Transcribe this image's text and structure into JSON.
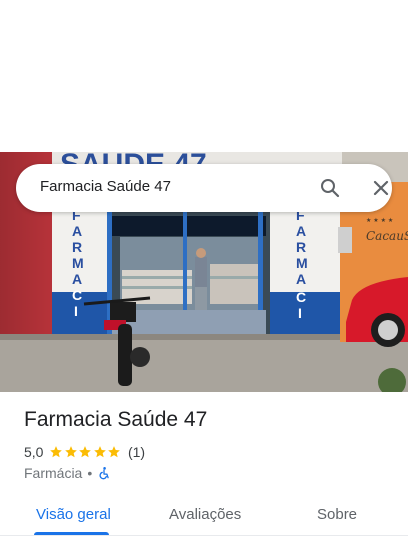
{
  "search": {
    "query": "Farmacia Saúde 47"
  },
  "photo": {
    "sign_text": "SAÚDE 47",
    "left_column_text": "FARMACIA",
    "right_column_text": "FARMACIA",
    "neighbor_sign": "CacauS",
    "neighbor_stars": "★ ★ ★ ★"
  },
  "place": {
    "title": "Farmacia Saúde 47",
    "rating": "5,0",
    "stars": 5,
    "review_count": "(1)",
    "category": "Farmácia",
    "separator": "•"
  },
  "tabs": [
    {
      "label": "Visão geral",
      "active": true
    },
    {
      "label": "Avaliações",
      "active": false
    },
    {
      "label": "Sobre",
      "active": false
    }
  ],
  "colors": {
    "accent": "#1a73e8",
    "star": "#fbbc04"
  },
  "icons": [
    "search-icon",
    "close-icon",
    "star-icon",
    "wheelchair-accessible-icon"
  ]
}
